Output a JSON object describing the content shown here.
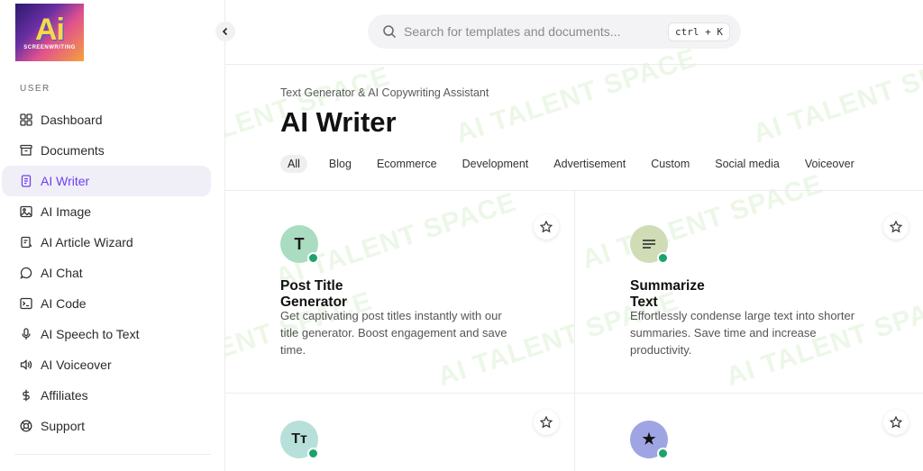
{
  "logo": {
    "big": "Ai",
    "small": "SCREENWRITING"
  },
  "sidebar": {
    "section_label": "USER",
    "items": [
      {
        "label": "Dashboard",
        "icon": "dashboard-icon"
      },
      {
        "label": "Documents",
        "icon": "archive-icon"
      },
      {
        "label": "AI Writer",
        "icon": "document-icon",
        "active": true
      },
      {
        "label": "AI Image",
        "icon": "image-icon"
      },
      {
        "label": "AI Article Wizard",
        "icon": "wizard-icon"
      },
      {
        "label": "AI Chat",
        "icon": "chat-icon"
      },
      {
        "label": "AI Code",
        "icon": "terminal-icon"
      },
      {
        "label": "AI Speech to Text",
        "icon": "microphone-icon"
      },
      {
        "label": "AI Voiceover",
        "icon": "speaker-icon"
      },
      {
        "label": "Affiliates",
        "icon": "dollar-icon"
      },
      {
        "label": "Support",
        "icon": "lifebuoy-icon"
      }
    ]
  },
  "search": {
    "placeholder": "Search for templates and documents...",
    "shortcut": "ctrl + K"
  },
  "header": {
    "subtitle": "Text Generator & AI Copywriting Assistant",
    "title": "AI Writer",
    "tabs": [
      "All",
      "Blog",
      "Ecommerce",
      "Development",
      "Advertisement",
      "Custom",
      "Social media",
      "Voiceover"
    ],
    "active_tab": "All"
  },
  "cards": [
    {
      "avatar_text": "T",
      "avatar_color": "#a9dcc1",
      "title": "Post Title Generator",
      "description": "Get captivating post titles instantly with our title generator. Boost engagement and save time."
    },
    {
      "avatar_text": "≡",
      "avatar_color": "#cfdcb6",
      "title": "Summarize Text",
      "description": "Effortlessly condense large text into shorter summaries. Save time and increase productivity."
    },
    {
      "avatar_text": "Tт",
      "avatar_color": "#b7e0da",
      "title": "",
      "description": ""
    },
    {
      "avatar_text": "★",
      "avatar_color": "#9fa4e3",
      "title": "",
      "description": ""
    }
  ],
  "watermark_text": "AI TALENT SPACE",
  "colors": {
    "accent": "#6d3ff0",
    "online": "#1aa46d"
  }
}
